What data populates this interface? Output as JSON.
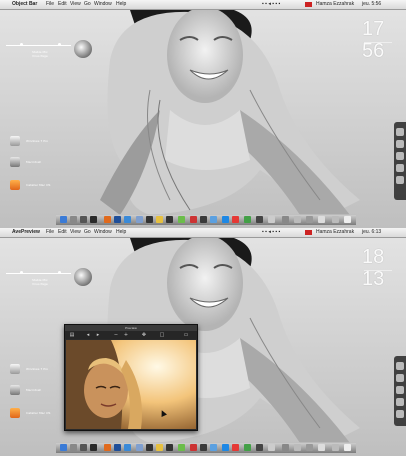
{
  "colors": {
    "menubar": "#e6e6e6",
    "clock_text": "#fafafa",
    "desktop": "#d7d7d7",
    "preview_bg": "#2a2a2a"
  },
  "top": {
    "apple_icon": "apple-logo-icon",
    "app_name": "Object Bar",
    "menus": [
      "File",
      "Edit",
      "View",
      "Go",
      "Window",
      "Help"
    ],
    "user_name": "Hamza Ezzahrak",
    "clock_status": "jeu. 5:56",
    "clock_hour": "17",
    "clock_min": "56",
    "widget_label": "Stable Mix",
    "widget_sublabel": "Virus Page",
    "desktop_items": [
      "Windows 7 Pro",
      "Macintosh",
      "Installer Mac OS"
    ]
  },
  "bottom": {
    "apple_icon": "apple-logo-icon",
    "app_name": "AvePreview",
    "menus": [
      "File",
      "Edit",
      "View",
      "Go",
      "Window",
      "Help"
    ],
    "user_name": "Hamza Ezzahrak",
    "clock_status": "jeu. 6:13",
    "clock_hour": "18",
    "clock_min": "13",
    "widget_label": "Stable Mix",
    "widget_sublabel": "Virus Page",
    "desktop_items": [
      "Windows 7 Pro",
      "Macintosh",
      "Installer Mac OS"
    ],
    "preview": {
      "title": "Preview"
    }
  }
}
